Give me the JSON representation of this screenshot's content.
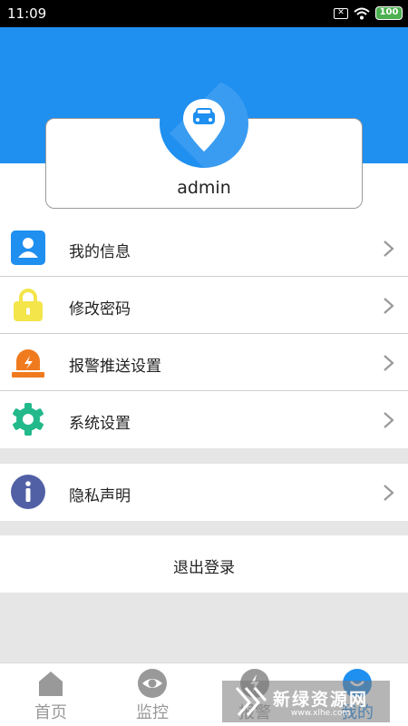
{
  "status_bar": {
    "time": "11:09",
    "battery": "100"
  },
  "profile": {
    "username": "admin"
  },
  "menu": [
    {
      "label": "我的信息",
      "icon": "user-info-icon",
      "color": "#1f8ff0"
    },
    {
      "label": "修改密码",
      "icon": "lock-icon",
      "color": "#f3e54a"
    },
    {
      "label": "报警推送设置",
      "icon": "alarm-light-icon",
      "color": "#f07a1e"
    },
    {
      "label": "系统设置",
      "icon": "gear-icon",
      "color": "#23b98a"
    },
    {
      "label": "隐私声明",
      "icon": "info-icon",
      "color": "#5160a5"
    }
  ],
  "logout_label": "退出登录",
  "tabs": [
    {
      "label": "首页",
      "icon": "home-icon"
    },
    {
      "label": "监控",
      "icon": "eye-icon"
    },
    {
      "label": "报警",
      "icon": "alarm-icon"
    },
    {
      "label": "我的",
      "icon": "profile-icon",
      "active": true
    }
  ],
  "watermark": {
    "title": "新绿资源网",
    "subtitle": "www.xlhe.com"
  },
  "colors": {
    "primary": "#1f8ff0",
    "background": "#e6e6e6"
  }
}
